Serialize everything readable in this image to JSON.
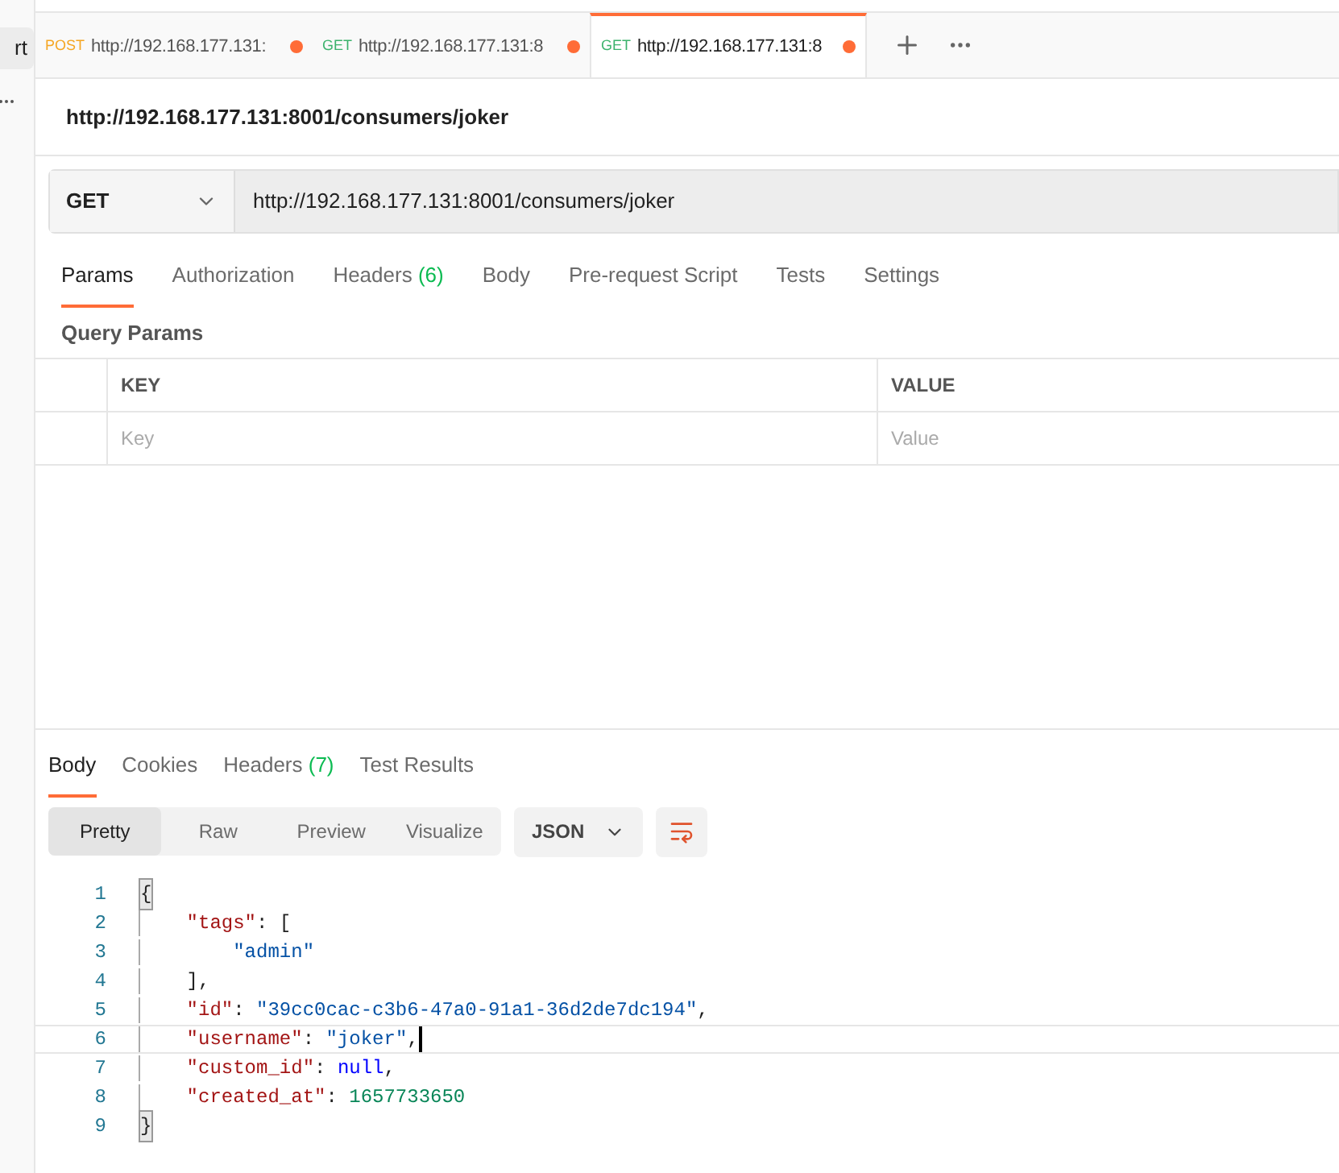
{
  "sidebar": {
    "top_label": "rt"
  },
  "tabs": [
    {
      "method": "POST",
      "url": "http://192.168.177.131:",
      "unsaved": true,
      "selected": false
    },
    {
      "method": "GET",
      "url": "http://192.168.177.131:8",
      "unsaved": true,
      "selected": false
    },
    {
      "method": "GET",
      "url": "http://192.168.177.131:8",
      "unsaved": true,
      "selected": true
    }
  ],
  "request": {
    "title": "http://192.168.177.131:8001/consumers/joker",
    "method": "GET",
    "url": "http://192.168.177.131:8001/consumers/joker"
  },
  "request_tabs": [
    {
      "label": "Params",
      "selected": true
    },
    {
      "label": "Authorization",
      "selected": false
    },
    {
      "label": "Headers",
      "count": "(6)",
      "selected": false
    },
    {
      "label": "Body",
      "selected": false
    },
    {
      "label": "Pre-request Script",
      "selected": false
    },
    {
      "label": "Tests",
      "selected": false
    },
    {
      "label": "Settings",
      "selected": false
    }
  ],
  "query_params": {
    "heading": "Query Params",
    "columns": [
      "KEY",
      "VALUE"
    ],
    "placeholders": [
      "Key",
      "Value"
    ]
  },
  "response_tabs": [
    {
      "label": "Body",
      "selected": true
    },
    {
      "label": "Cookies",
      "selected": false
    },
    {
      "label": "Headers",
      "count": "(7)",
      "selected": false
    },
    {
      "label": "Test Results",
      "selected": false
    }
  ],
  "view_modes": [
    {
      "label": "Pretty",
      "selected": true
    },
    {
      "label": "Raw",
      "selected": false
    },
    {
      "label": "Preview",
      "selected": false
    },
    {
      "label": "Visualize",
      "selected": false
    }
  ],
  "format": "JSON",
  "code": [
    {
      "number": "1",
      "current": false,
      "tokens": [
        {
          "kind": "bracket",
          "text": "{"
        }
      ]
    },
    {
      "number": "2",
      "current": false,
      "tokens": [
        {
          "kind": "key",
          "text": "    \"tags\""
        },
        {
          "kind": "punct",
          "text": ": ["
        }
      ]
    },
    {
      "number": "3",
      "current": false,
      "tokens": [
        {
          "kind": "string",
          "text": "        \"admin\""
        }
      ]
    },
    {
      "number": "4",
      "current": false,
      "tokens": [
        {
          "kind": "punct",
          "text": "    ],"
        }
      ]
    },
    {
      "number": "5",
      "current": false,
      "tokens": [
        {
          "kind": "key",
          "text": "    \"id\""
        },
        {
          "kind": "punct",
          "text": ": "
        },
        {
          "kind": "string",
          "text": "\"39cc0cac-c3b6-47a0-91a1-36d2de7dc194\""
        },
        {
          "kind": "punct",
          "text": ","
        }
      ]
    },
    {
      "number": "6",
      "current": true,
      "tokens": [
        {
          "kind": "key",
          "text": "    \"username\""
        },
        {
          "kind": "punct",
          "text": ": "
        },
        {
          "kind": "string",
          "text": "\"joker\""
        },
        {
          "kind": "punct",
          "text": ","
        }
      ]
    },
    {
      "number": "7",
      "current": false,
      "tokens": [
        {
          "kind": "key",
          "text": "    \"custom_id\""
        },
        {
          "kind": "punct",
          "text": ": "
        },
        {
          "kind": "null",
          "text": "null"
        },
        {
          "kind": "punct",
          "text": ","
        }
      ]
    },
    {
      "number": "8",
      "current": false,
      "tokens": [
        {
          "kind": "key",
          "text": "    \"created_at\""
        },
        {
          "kind": "punct",
          "text": ": "
        },
        {
          "kind": "number",
          "text": "1657733650"
        }
      ]
    },
    {
      "number": "9",
      "current": false,
      "tokens": [
        {
          "kind": "bracket",
          "text": "}"
        }
      ]
    }
  ]
}
